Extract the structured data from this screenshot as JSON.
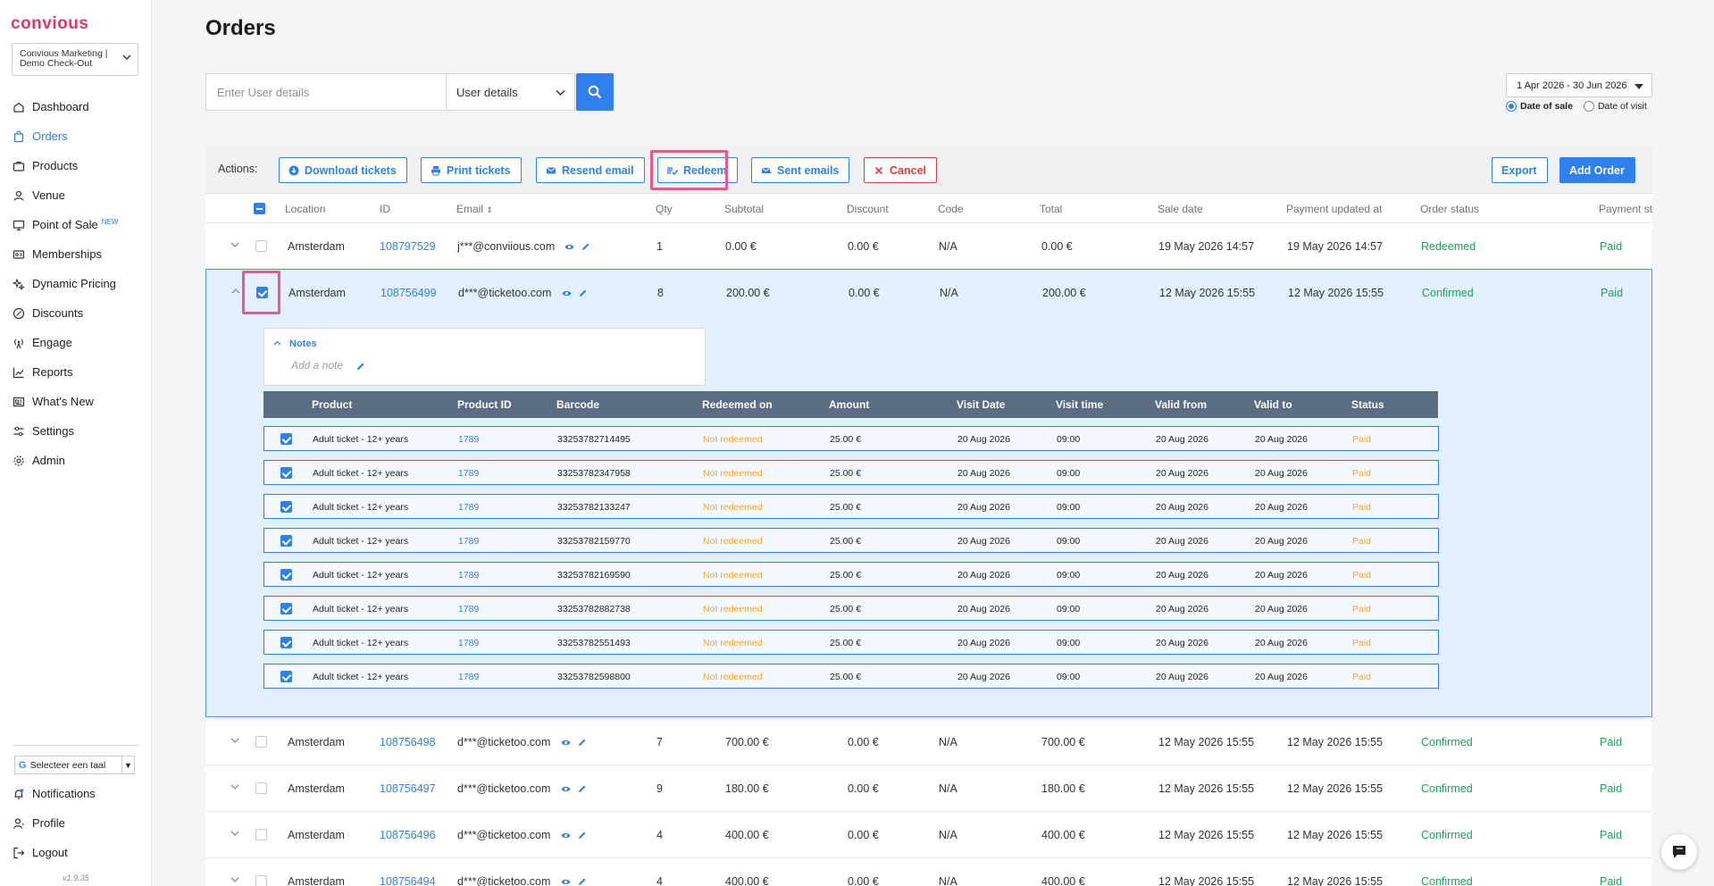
{
  "app": {
    "logo": "convious",
    "account": "Convious Marketing | Demo Check-Out",
    "version": "v1.9.35"
  },
  "sidebar": {
    "items": [
      {
        "label": "Dashboard",
        "icon": "home-icon"
      },
      {
        "label": "Orders",
        "icon": "shopping-bag-icon",
        "active": true
      },
      {
        "label": "Products",
        "icon": "briefcase-icon"
      },
      {
        "label": "Venue",
        "icon": "user-pin-icon"
      },
      {
        "label": "Point of Sale",
        "icon": "monitor-icon",
        "badge": "NEW"
      },
      {
        "label": "Memberships",
        "icon": "id-card-icon"
      },
      {
        "label": "Dynamic Pricing",
        "icon": "sparkle-icon"
      },
      {
        "label": "Discounts",
        "icon": "discount-icon"
      },
      {
        "label": "Engage",
        "icon": "broadcast-icon"
      },
      {
        "label": "Reports",
        "icon": "chart-icon"
      },
      {
        "label": "What's New",
        "icon": "news-icon"
      },
      {
        "label": "Settings",
        "icon": "sliders-icon"
      },
      {
        "label": "Admin",
        "icon": "gear-icon"
      }
    ],
    "language_select": "Selecteer een taal",
    "bottom": [
      {
        "label": "Notifications",
        "icon": "bell-icon"
      },
      {
        "label": "Profile",
        "icon": "person-icon"
      },
      {
        "label": "Logout",
        "icon": "logout-icon"
      }
    ]
  },
  "page": {
    "title": "Orders",
    "search_placeholder": "Enter User details",
    "search_type": "User details",
    "date_range": "1 Apr 2026 - 30 Jun 2026",
    "date_options": [
      "Date of sale",
      "Date of visit"
    ],
    "date_selected": "Date of sale"
  },
  "actions": {
    "label": "Actions:",
    "download": "Download tickets",
    "print": "Print tickets",
    "resend": "Resend email",
    "redeem": "Redeem",
    "sent": "Sent emails",
    "cancel": "Cancel",
    "export": "Export",
    "add_order": "Add Order"
  },
  "table": {
    "headers": [
      "Location",
      "ID",
      "Email",
      "Qty",
      "Subtotal",
      "Discount",
      "Code",
      "Total",
      "Sale date",
      "Payment updated at",
      "Order status",
      "Payment st"
    ],
    "rows": [
      {
        "location": "Amsterdam",
        "id": "108797529",
        "email": "j***@conviious.com",
        "qty": "1",
        "subtotal": "0.00 €",
        "discount": "0.00 €",
        "code": "N/A",
        "total": "0.00 €",
        "sale_date": "19 May 2026 14:57",
        "payment_updated": "19 May 2026 14:57",
        "status": "Redeemed",
        "payment": "Paid"
      },
      {
        "location": "Amsterdam",
        "id": "108756499",
        "email": "d***@ticketoo.com",
        "qty": "8",
        "subtotal": "200.00 €",
        "discount": "0.00 €",
        "code": "N/A",
        "total": "200.00 €",
        "sale_date": "12 May 2026 15:55",
        "payment_updated": "12 May 2026 15:55",
        "status": "Confirmed",
        "payment": "Paid",
        "expanded": true,
        "selected": true
      },
      {
        "location": "Amsterdam",
        "id": "108756498",
        "email": "d***@ticketoo.com",
        "qty": "7",
        "subtotal": "700.00 €",
        "discount": "0.00 €",
        "code": "N/A",
        "total": "700.00 €",
        "sale_date": "12 May 2026 15:55",
        "payment_updated": "12 May 2026 15:55",
        "status": "Confirmed",
        "payment": "Paid"
      },
      {
        "location": "Amsterdam",
        "id": "108756497",
        "email": "d***@ticketoo.com",
        "qty": "9",
        "subtotal": "180.00 €",
        "discount": "0.00 €",
        "code": "N/A",
        "total": "180.00 €",
        "sale_date": "12 May 2026 15:55",
        "payment_updated": "12 May 2026 15:55",
        "status": "Confirmed",
        "payment": "Paid"
      },
      {
        "location": "Amsterdam",
        "id": "108756496",
        "email": "d***@ticketoo.com",
        "qty": "4",
        "subtotal": "400.00 €",
        "discount": "0.00 €",
        "code": "N/A",
        "total": "400.00 €",
        "sale_date": "12 May 2026 15:55",
        "payment_updated": "12 May 2026 15:55",
        "status": "Confirmed",
        "payment": "Paid"
      },
      {
        "location": "Amsterdam",
        "id": "108756494",
        "email": "d***@ticketoo.com",
        "qty": "4",
        "subtotal": "400.00 €",
        "discount": "0.00 €",
        "code": "N/A",
        "total": "400.00 €",
        "sale_date": "12 May 2026 15:55",
        "payment_updated": "12 May 2026 15:55",
        "status": "Confirmed",
        "payment": "Paid"
      }
    ]
  },
  "details": {
    "notes_title": "Notes",
    "notes_placeholder": "Add a note",
    "headers": [
      "Product",
      "Product ID",
      "Barcode",
      "Redeemed on",
      "Amount",
      "Visit Date",
      "Visit time",
      "Valid from",
      "Valid to",
      "Status"
    ],
    "items": [
      {
        "product": "Adult ticket - 12+ years",
        "product_id": "1789",
        "barcode": "33253782714495",
        "redeemed_on": "Not redeemed",
        "amount": "25.00 €",
        "visit_date": "20 Aug 2026",
        "visit_time": "09:00",
        "valid_from": "20 Aug 2026",
        "valid_to": "20 Aug 2026",
        "status": "Paid"
      },
      {
        "product": "Adult ticket - 12+ years",
        "product_id": "1789",
        "barcode": "33253782347958",
        "redeemed_on": "Not redeemed",
        "amount": "25.00 €",
        "visit_date": "20 Aug 2026",
        "visit_time": "09:00",
        "valid_from": "20 Aug 2026",
        "valid_to": "20 Aug 2026",
        "status": "Paid"
      },
      {
        "product": "Adult ticket - 12+ years",
        "product_id": "1789",
        "barcode": "33253782133247",
        "redeemed_on": "Not redeemed",
        "amount": "25.00 €",
        "visit_date": "20 Aug 2026",
        "visit_time": "09:00",
        "valid_from": "20 Aug 2026",
        "valid_to": "20 Aug 2026",
        "status": "Paid"
      },
      {
        "product": "Adult ticket - 12+ years",
        "product_id": "1789",
        "barcode": "33253782159770",
        "redeemed_on": "Not redeemed",
        "amount": "25.00 €",
        "visit_date": "20 Aug 2026",
        "visit_time": "09:00",
        "valid_from": "20 Aug 2026",
        "valid_to": "20 Aug 2026",
        "status": "Paid"
      },
      {
        "product": "Adult ticket - 12+ years",
        "product_id": "1789",
        "barcode": "33253782169590",
        "redeemed_on": "Not redeemed",
        "amount": "25.00 €",
        "visit_date": "20 Aug 2026",
        "visit_time": "09:00",
        "valid_from": "20 Aug 2026",
        "valid_to": "20 Aug 2026",
        "status": "Paid"
      },
      {
        "product": "Adult ticket - 12+ years",
        "product_id": "1789",
        "barcode": "33253782882738",
        "redeemed_on": "Not redeemed",
        "amount": "25.00 €",
        "visit_date": "20 Aug 2026",
        "visit_time": "09:00",
        "valid_from": "20 Aug 2026",
        "valid_to": "20 Aug 2026",
        "status": "Paid"
      },
      {
        "product": "Adult ticket - 12+ years",
        "product_id": "1789",
        "barcode": "33253782551493",
        "redeemed_on": "Not redeemed",
        "amount": "25.00 €",
        "visit_date": "20 Aug 2026",
        "visit_time": "09:00",
        "valid_from": "20 Aug 2026",
        "valid_to": "20 Aug 2026",
        "status": "Paid"
      },
      {
        "product": "Adult ticket - 12+ years",
        "product_id": "1789",
        "barcode": "33253782598800",
        "redeemed_on": "Not redeemed",
        "amount": "25.00 €",
        "visit_date": "20 Aug 2026",
        "visit_time": "09:00",
        "valid_from": "20 Aug 2026",
        "valid_to": "20 Aug 2026",
        "status": "Paid"
      }
    ]
  },
  "colors": {
    "brand": "#e8336a",
    "accent": "#2f80ed",
    "success": "#1aa35a",
    "warning": "#f5a623",
    "danger": "#e03b3b",
    "highlight": "#e85a8b"
  }
}
